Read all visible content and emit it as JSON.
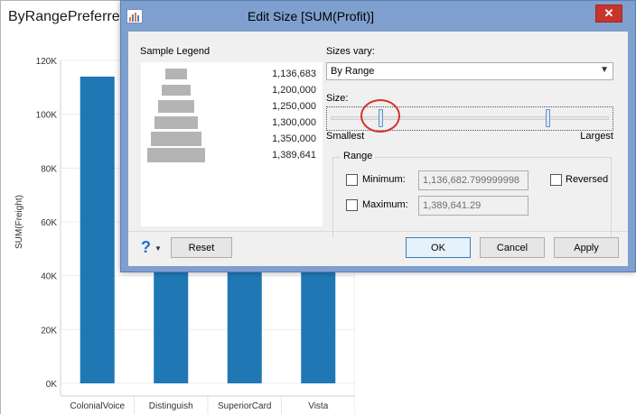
{
  "sheet": {
    "title": "ByRangePreferre"
  },
  "chart_data": {
    "type": "bar",
    "categories": [
      "ColonialVoice",
      "Distinguish",
      "SuperiorCard",
      "Vista"
    ],
    "series": [
      {
        "values": [
          114000,
          44000,
          44000,
          44000
        ]
      }
    ],
    "ylabel": "SUM(Freight)",
    "ylim": [
      0,
      120000
    ],
    "yticks": [
      "0K",
      "20K",
      "40K",
      "60K",
      "80K",
      "100K",
      "120K"
    ],
    "bar_color": "#1f77b4",
    "grid": true
  },
  "dialog": {
    "title": "Edit Size [SUM(Profit)]",
    "close_symbol": "✕",
    "legend": {
      "label": "Sample Legend",
      "values": [
        "1,136,683",
        "1,200,000",
        "1,250,000",
        "1,300,000",
        "1,350,000",
        "1,389,641"
      ]
    },
    "sizes_vary": {
      "label": "Sizes vary:",
      "selected": "By Range"
    },
    "size": {
      "label": "Size:",
      "min_label": "Smallest",
      "max_label": "Largest",
      "min_thumb": 0.18,
      "max_thumb": 0.78
    },
    "range": {
      "title": "Range",
      "minimum_label": "Minimum:",
      "minimum_value": "1,136,682.799999998",
      "maximum_label": "Maximum:",
      "maximum_value": "1,389,641.29",
      "reversed_label": "Reversed"
    },
    "buttons": {
      "help": "?",
      "reset": "Reset",
      "ok": "OK",
      "cancel": "Cancel",
      "apply": "Apply"
    }
  }
}
